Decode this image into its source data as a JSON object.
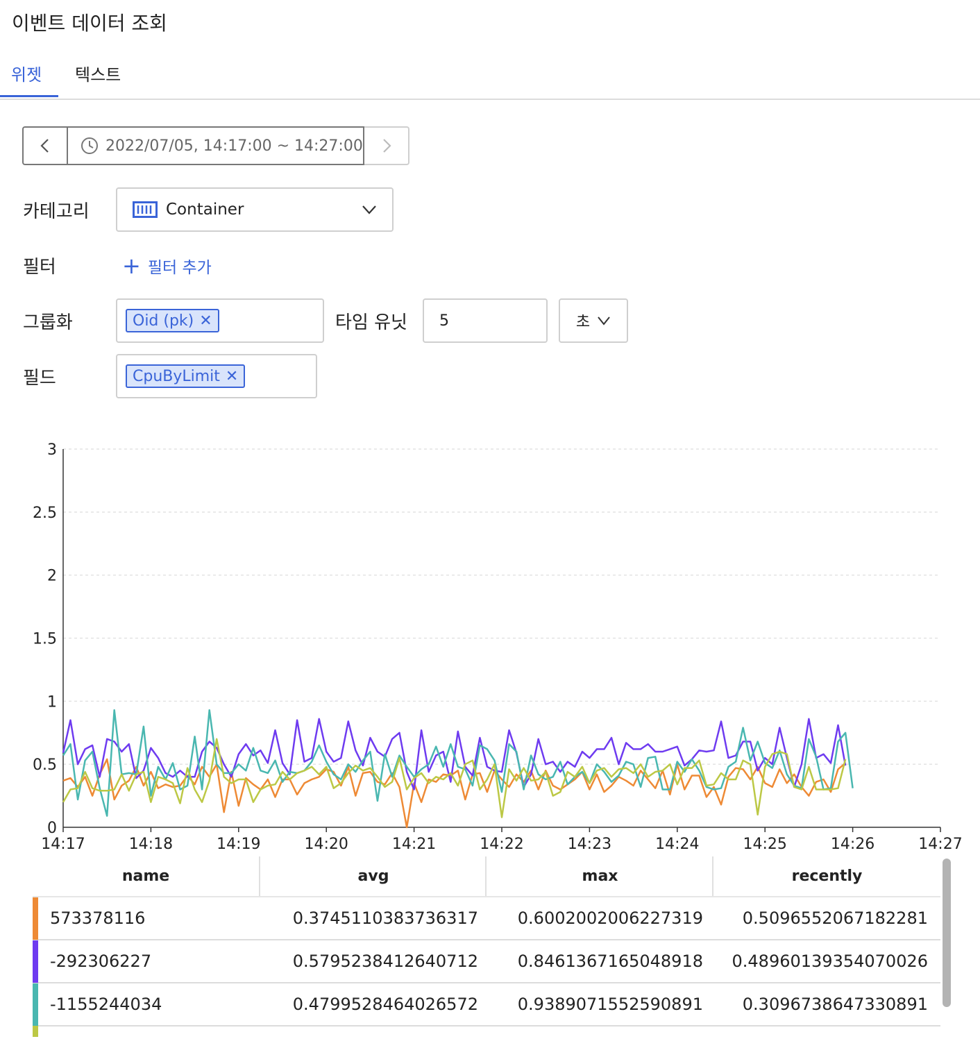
{
  "page": {
    "title": "이벤트 데이터 조회"
  },
  "tabs": [
    {
      "label": "위젯",
      "active": true
    },
    {
      "label": "텍스트",
      "active": false
    }
  ],
  "time_range": {
    "label": "2022/07/05, 14:17:00 ~ 14:27:00"
  },
  "form": {
    "category": {
      "label": "카테고리",
      "value": "Container",
      "icon": "container-icon"
    },
    "filter": {
      "label": "필터",
      "add_label": "필터 추가"
    },
    "group": {
      "label": "그룹화",
      "tags": [
        "Oid (pk)"
      ]
    },
    "time_unit": {
      "label": "타임 유닛",
      "value": "5",
      "unit": "초"
    },
    "field": {
      "label": "필드",
      "tags": [
        "CpuByLimit"
      ]
    }
  },
  "chart_data": {
    "type": "line",
    "ylim": [
      0,
      3
    ],
    "yticks": [
      "0",
      "0.5",
      "1",
      "1.5",
      "2",
      "2.5",
      "3"
    ],
    "xticks": [
      "14:17",
      "14:18",
      "14:19",
      "14:20",
      "14:21",
      "14:22",
      "14:23",
      "14:24",
      "14:25",
      "14:26",
      "14:27"
    ],
    "grid": true,
    "series": [
      {
        "name": "573378116",
        "color": "#ee8a35",
        "values": [
          0.37,
          0.39,
          0.32,
          0.4,
          0.25,
          0.42,
          0.54,
          0.22,
          0.33,
          0.37,
          0.48,
          0.33,
          0.44,
          0.31,
          0.34,
          0.32,
          0.33,
          0.41,
          0.34,
          0.48,
          0.4,
          0.5,
          0.12,
          0.44,
          0.17,
          0.39,
          0.34,
          0.3,
          0.38,
          0.24,
          0.38,
          0.38,
          0.26,
          0.35,
          0.38,
          0.4,
          0.46,
          0.44,
          0.33,
          0.48,
          0.25,
          0.43,
          0.44,
          0.36,
          0.34,
          0.43,
          0.32,
          0.0,
          0.35,
          0.2,
          0.38,
          0.36,
          0.42,
          0.41,
          0.45,
          0.22,
          0.42,
          0.43,
          0.28,
          0.45,
          0.38,
          0.32,
          0.42,
          0.36,
          0.45,
          0.3,
          0.45,
          0.33,
          0.3,
          0.34,
          0.38,
          0.44,
          0.3,
          0.42,
          0.28,
          0.33,
          0.4,
          0.37,
          0.33,
          0.45,
          0.38,
          0.31,
          0.45,
          0.26,
          0.5,
          0.3,
          0.41,
          0.41,
          0.24,
          0.32,
          0.18,
          0.4,
          0.47,
          0.46,
          0.38,
          0.48,
          0.35,
          0.32,
          0.46,
          0.35,
          0.42,
          0.32,
          0.25,
          0.36,
          0.38,
          0.28,
          0.46,
          0.51
        ]
      },
      {
        "name": "-292306227",
        "color": "#6e3bf0",
        "values": [
          0.59,
          0.85,
          0.5,
          0.62,
          0.65,
          0.4,
          0.7,
          0.68,
          0.6,
          0.66,
          0.39,
          0.45,
          0.63,
          0.55,
          0.43,
          0.4,
          0.45,
          0.4,
          0.4,
          0.6,
          0.68,
          0.63,
          0.5,
          0.4,
          0.58,
          0.66,
          0.57,
          0.61,
          0.51,
          0.77,
          0.51,
          0.42,
          0.85,
          0.52,
          0.55,
          0.86,
          0.6,
          0.52,
          0.55,
          0.84,
          0.61,
          0.49,
          0.71,
          0.6,
          0.56,
          0.7,
          0.75,
          0.44,
          0.3,
          0.77,
          0.44,
          0.57,
          0.6,
          0.36,
          0.76,
          0.48,
          0.41,
          0.71,
          0.48,
          0.45,
          0.44,
          0.77,
          0.59,
          0.32,
          0.42,
          0.7,
          0.5,
          0.52,
          0.44,
          0.52,
          0.48,
          0.6,
          0.55,
          0.62,
          0.62,
          0.71,
          0.5,
          0.67,
          0.62,
          0.62,
          0.66,
          0.6,
          0.6,
          0.62,
          0.64,
          0.49,
          0.54,
          0.61,
          0.6,
          0.61,
          0.84,
          0.55,
          0.57,
          0.68,
          0.68,
          0.45,
          0.55,
          0.5,
          0.79,
          0.55,
          0.32,
          0.5,
          0.86,
          0.55,
          0.58,
          0.51,
          0.81,
          0.49
        ]
      },
      {
        "name": "-1155244034",
        "color": "#49b7b0",
        "values": [
          0.57,
          0.66,
          0.22,
          0.53,
          0.6,
          0.31,
          0.09,
          0.93,
          0.42,
          0.43,
          0.42,
          0.8,
          0.25,
          0.48,
          0.38,
          0.51,
          0.3,
          0.33,
          0.72,
          0.3,
          0.93,
          0.5,
          0.43,
          0.43,
          0.5,
          0.45,
          0.63,
          0.45,
          0.43,
          0.53,
          0.36,
          0.44,
          0.43,
          0.45,
          0.52,
          0.65,
          0.52,
          0.42,
          0.38,
          0.5,
          0.44,
          0.53,
          0.6,
          0.21,
          0.58,
          0.4,
          0.57,
          0.48,
          0.4,
          0.46,
          0.5,
          0.64,
          0.48,
          0.66,
          0.48,
          0.46,
          0.33,
          0.65,
          0.62,
          0.53,
          0.28,
          0.66,
          0.6,
          0.3,
          0.57,
          0.42,
          0.38,
          0.4,
          0.52,
          0.34,
          0.4,
          0.44,
          0.35,
          0.5,
          0.44,
          0.36,
          0.41,
          0.52,
          0.5,
          0.32,
          0.55,
          0.56,
          0.3,
          0.3,
          0.52,
          0.44,
          0.54,
          0.45,
          0.32,
          0.3,
          0.31,
          0.48,
          0.52,
          0.79,
          0.53,
          0.68,
          0.51,
          0.47,
          0.61,
          0.42,
          0.33,
          0.31,
          0.7,
          0.56,
          0.3,
          0.31,
          0.68,
          0.75,
          0.31
        ]
      },
      {
        "name": "",
        "color": "#bcc845",
        "values": [
          0.2,
          0.3,
          0.31,
          0.44,
          0.31,
          0.29,
          0.29,
          0.3,
          0.42,
          0.29,
          0.42,
          0.44,
          0.2,
          0.4,
          0.38,
          0.35,
          0.19,
          0.47,
          0.3,
          0.2,
          0.37,
          0.7,
          0.4,
          0.35,
          0.38,
          0.38,
          0.2,
          0.3,
          0.33,
          0.34,
          0.44,
          0.38,
          0.43,
          0.45,
          0.48,
          0.42,
          0.48,
          0.31,
          0.35,
          0.43,
          0.49,
          0.45,
          0.47,
          0.4,
          0.32,
          0.36,
          0.55,
          0.3,
          0.39,
          0.43,
          0.35,
          0.4,
          0.38,
          0.43,
          0.33,
          0.5,
          0.53,
          0.3,
          0.38,
          0.5,
          0.08,
          0.46,
          0.37,
          0.47,
          0.37,
          0.38,
          0.44,
          0.25,
          0.28,
          0.44,
          0.4,
          0.48,
          0.35,
          0.45,
          0.47,
          0.4,
          0.46,
          0.47,
          0.43,
          0.5,
          0.4,
          0.44,
          0.45,
          0.5,
          0.34,
          0.47,
          0.47,
          0.53,
          0.33,
          0.34,
          0.43,
          0.38,
          0.38,
          0.53,
          0.5,
          0.1,
          0.48,
          0.58,
          0.6,
          0.58,
          0.32,
          0.3,
          0.48,
          0.3,
          0.3,
          0.3,
          0.31,
          0.54
        ]
      }
    ]
  },
  "table": {
    "columns": [
      "name",
      "avg",
      "max",
      "recently"
    ],
    "rows": [
      {
        "color": "#ee8a35",
        "name": "573378116",
        "avg": "0.3745110383736317",
        "max": "0.6002002006227319",
        "recently": "0.5096552067182281"
      },
      {
        "color": "#6e3bf0",
        "name": "-292306227",
        "avg": "0.5795238412640712",
        "max": "0.8461367165048918",
        "recently": "0.48960139354070026"
      },
      {
        "color": "#49b7b0",
        "name": "-1155244034",
        "avg": "0.4799528464026572",
        "max": "0.9389071552590891",
        "recently": "0.3096738647330891"
      }
    ]
  }
}
